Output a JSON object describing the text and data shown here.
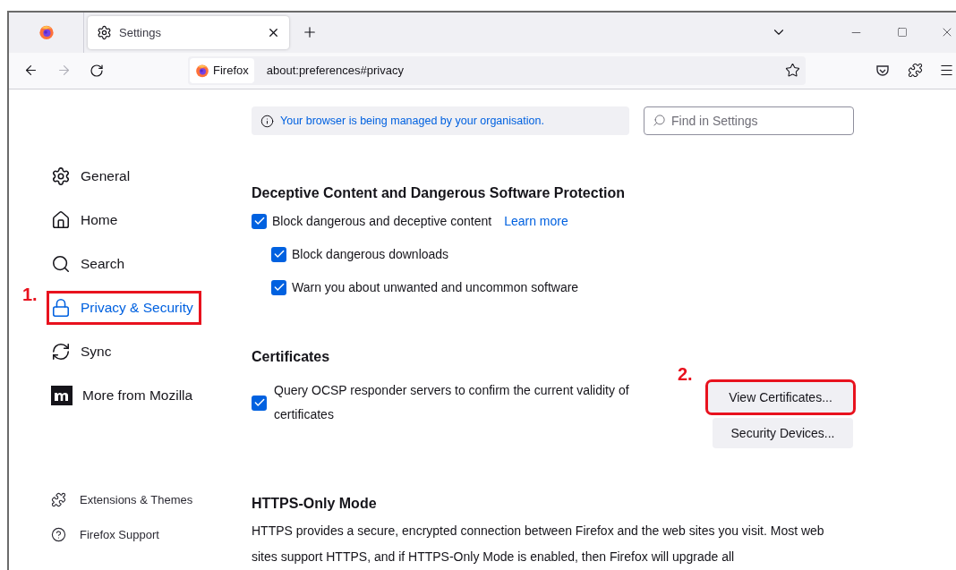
{
  "tabs": [
    {
      "label": "Settings",
      "selected": true
    }
  ],
  "address_bar": {
    "identity": "Firefox",
    "url": "about:preferences#privacy"
  },
  "notice": {
    "text": "Your browser is being managed by your organisation."
  },
  "search": {
    "placeholder": "Find in Settings"
  },
  "sidebar": {
    "items": [
      {
        "label": "General",
        "kind": "gear",
        "selected": false,
        "highlighted": false
      },
      {
        "label": "Home",
        "kind": "home",
        "selected": false,
        "highlighted": false
      },
      {
        "label": "Search",
        "kind": "search",
        "selected": false,
        "highlighted": false
      },
      {
        "label": "Privacy & Security",
        "kind": "lock",
        "selected": true,
        "highlighted": true,
        "annotation": "1."
      },
      {
        "label": "Sync",
        "kind": "sync",
        "selected": false,
        "highlighted": false
      },
      {
        "label": "More from Mozilla",
        "kind": "mozilla",
        "selected": false,
        "highlighted": false
      }
    ],
    "footer_items": [
      {
        "label": "Extensions & Themes",
        "kind": "puzzle"
      },
      {
        "label": "Firefox Support",
        "kind": "help"
      }
    ]
  },
  "sections": [
    {
      "title": "Deceptive Content and Dangerous Software Protection",
      "options": [
        {
          "label": "Block dangerous and deceptive content",
          "checked": true,
          "nested": false,
          "link": "Learn more"
        },
        {
          "label": "Block dangerous downloads",
          "checked": true,
          "nested": true
        },
        {
          "label": "Warn you about unwanted and uncommon software",
          "checked": true,
          "nested": true
        }
      ]
    },
    {
      "title": "Certificates",
      "options": [
        {
          "label": "Query OCSP responder servers to confirm the current validity of certificates",
          "checked": true,
          "nested": false
        }
      ],
      "buttons": [
        {
          "label": "View Certificates...",
          "highlighted": true,
          "annotation": "2."
        },
        {
          "label": "Security Devices...",
          "highlighted": false
        }
      ]
    },
    {
      "title": "HTTPS-Only Mode",
      "paragraph": "HTTPS provides a secure, encrypted connection between Firefox and the web sites you visit. Most web sites support HTTPS, and if HTTPS-Only Mode is enabled, then Firefox will upgrade all"
    }
  ]
}
